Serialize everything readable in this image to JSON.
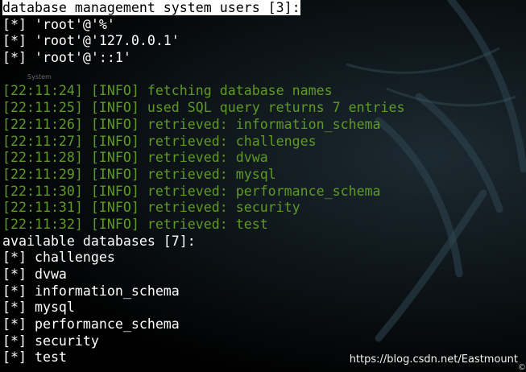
{
  "terminal": {
    "lines": [
      {
        "text": "database management system users [3]:",
        "type": "output",
        "highlight": true
      },
      {
        "text": "[*] 'root'@'%'",
        "type": "output"
      },
      {
        "text": "[*] 'root'@'127.0.0.1'",
        "type": "output"
      },
      {
        "text": "[*] 'root'@'::1'",
        "type": "output"
      },
      {
        "text": "",
        "type": "blank"
      },
      {
        "text": "[22:11:24] [INFO] fetching database names",
        "type": "log"
      },
      {
        "text": "[22:11:25] [INFO] used SQL query returns 7 entries",
        "type": "log"
      },
      {
        "text": "[22:11:26] [INFO] retrieved: information_schema",
        "type": "log"
      },
      {
        "text": "[22:11:27] [INFO] retrieved: challenges",
        "type": "log"
      },
      {
        "text": "[22:11:28] [INFO] retrieved: dvwa",
        "type": "log"
      },
      {
        "text": "[22:11:29] [INFO] retrieved: mysql",
        "type": "log"
      },
      {
        "text": "[22:11:30] [INFO] retrieved: performance_schema",
        "type": "log"
      },
      {
        "text": "[22:11:31] [INFO] retrieved: security",
        "type": "log"
      },
      {
        "text": "[22:11:32] [INFO] retrieved: test",
        "type": "log"
      },
      {
        "text": "available databases [7]:",
        "type": "output"
      },
      {
        "text": "[*] challenges",
        "type": "output"
      },
      {
        "text": "[*] dvwa",
        "type": "output"
      },
      {
        "text": "[*] information_schema",
        "type": "output"
      },
      {
        "text": "[*] mysql",
        "type": "output"
      },
      {
        "text": "[*] performance_schema",
        "type": "output"
      },
      {
        "text": "[*] security",
        "type": "output"
      },
      {
        "text": "[*] test",
        "type": "output"
      }
    ],
    "ghost_label": "System",
    "watermark": "https://blog.csdn.net/Eastmount",
    "corner_glyph": "©"
  },
  "colors": {
    "background": "#000000",
    "output_text": "#ffffff",
    "log_text": "#5f9a27",
    "highlight_bg": "#ffffff",
    "highlight_fg": "#000000"
  }
}
